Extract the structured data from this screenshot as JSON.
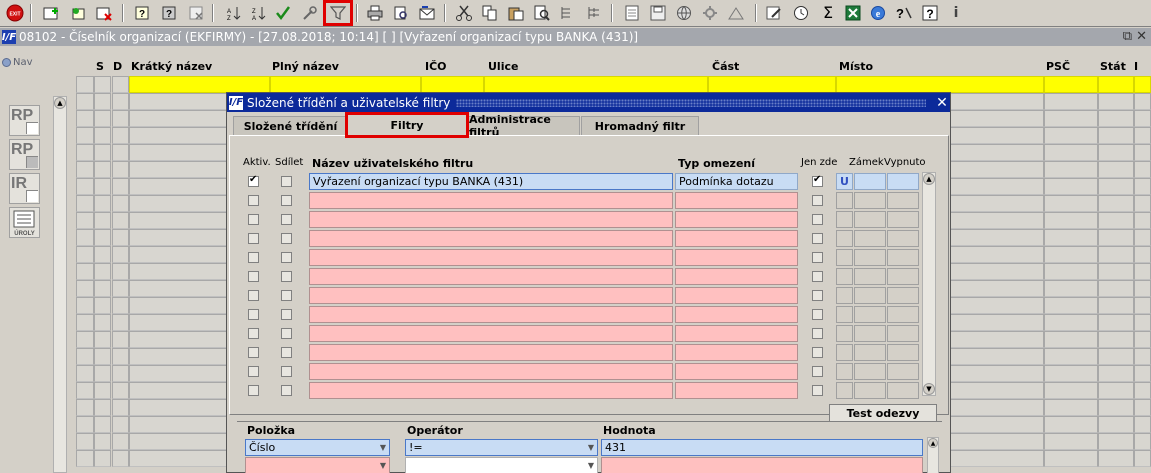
{
  "window": {
    "title": "08102 - Číselník organizací (EKFIRMY) - [27.08.2018; 10:14]  [ ]  [Vyřazení organizací typu BANKA (431)]"
  },
  "toolbar": {
    "icons": [
      "exit-icon",
      "insert-record-icon",
      "copy-record-icon",
      "delete-record-icon",
      "query-icon",
      "execute-query-icon",
      "cancel-query-icon",
      "sort-asc-icon",
      "sort-desc-icon",
      "commit-icon",
      "tools-icon",
      "filter-icon",
      "print-icon",
      "print-preview-icon",
      "send-mail-icon",
      "cut-icon",
      "copy-icon",
      "paste-icon",
      "find-icon",
      "outline-icon",
      "tree-icon",
      "new-doc-icon",
      "save-icon",
      "globe-icon",
      "settings-icon",
      "chart-icon",
      "edit-icon",
      "clock-icon",
      "sum-icon",
      "excel-icon",
      "browser-icon",
      "help-query-icon",
      "help-icon",
      "info-icon"
    ],
    "exit_label": "EXIT",
    "sum_symbol": "Σ",
    "info_symbol": "i"
  },
  "sidebar": {
    "nav_label": "Nav",
    "buttons": [
      {
        "label": "RP",
        "name": "rp-report-button"
      },
      {
        "label": "RP",
        "name": "rp-report-grid-button"
      },
      {
        "label": "IR",
        "name": "ir-report-button"
      },
      {
        "label": "ÚROLY",
        "name": "uroly-button"
      }
    ]
  },
  "grid": {
    "columns": [
      "S",
      "D",
      "Krátký název",
      "Plný název",
      "IČO",
      "Ulice",
      "Část",
      "Místo",
      "PSČ",
      "Stát",
      "I"
    ]
  },
  "dialog": {
    "title": "Složené třídění a uživatelské filtry",
    "tabs": [
      "Složené třídění",
      "Filtry",
      "Administrace filtrů",
      "Hromadný filtr"
    ],
    "active_tab": "Filtry",
    "headers": {
      "aktiv": "Aktiv.",
      "sdilet": "Sdílet",
      "nazev": "Název uživatelského filtru",
      "typ": "Typ omezení",
      "jen_zde": "Jen zde",
      "zamek": "Zámek",
      "vypnuto": "Vypnuto"
    },
    "filters": [
      {
        "aktiv": true,
        "sdilet": false,
        "nazev": "Vyřazení organizací typu BANKA (431)",
        "typ": "Podmínka dotazu",
        "jen_zde": true,
        "zamek": "U",
        "vypnuto": ""
      }
    ],
    "empty_rows": 11,
    "test_button": "Test odezvy",
    "lower": {
      "headers": {
        "polozka": "Položka",
        "operator": "Operátor",
        "hodnota": "Hodnota"
      },
      "rows": [
        {
          "polozka": "Číslo",
          "operator": "!=",
          "hodnota": "431"
        },
        {
          "polozka": "",
          "operator": "",
          "hodnota": ""
        }
      ]
    }
  }
}
